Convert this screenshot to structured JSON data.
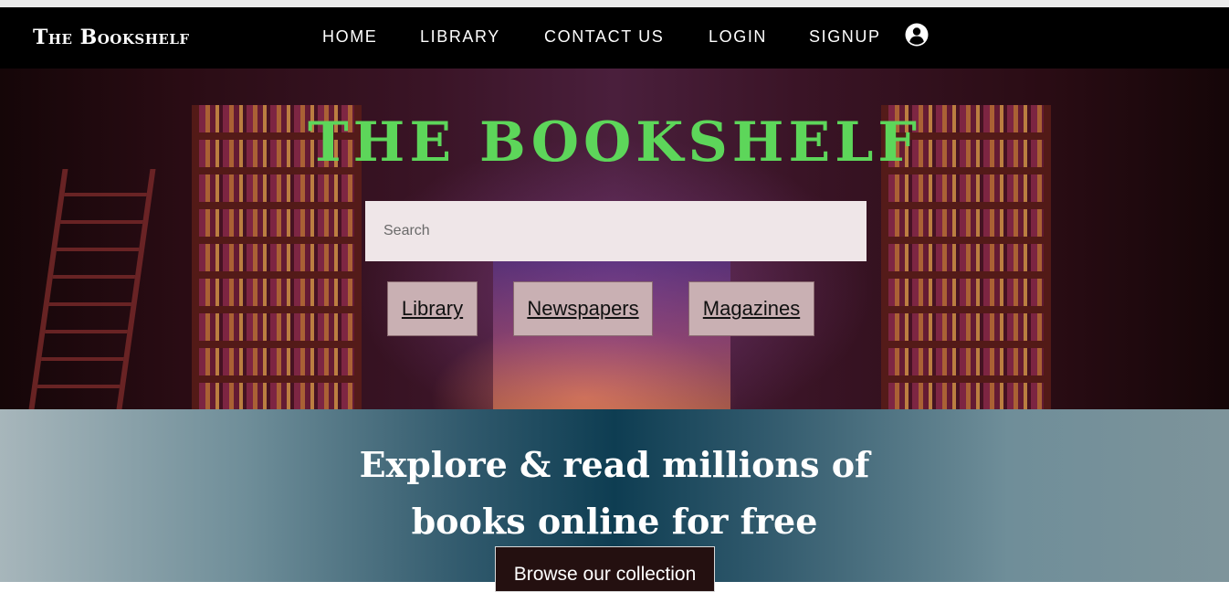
{
  "navbar": {
    "brand": "The Bookshelf",
    "links": [
      "HOME",
      "LIBRARY",
      "CONTACT US",
      "LOGIN",
      "SIGNUP"
    ],
    "user_icon": "user-circle-icon"
  },
  "hero": {
    "title": "THE BOOKSHELF",
    "search_placeholder": "Search",
    "chips": [
      "Library",
      "Newspapers",
      "Magazines"
    ],
    "title_color": "#5dd65a"
  },
  "band": {
    "tagline_line1": "Explore & read millions of",
    "tagline_line2": "books online for free",
    "browse_label": "Browse our collection"
  }
}
